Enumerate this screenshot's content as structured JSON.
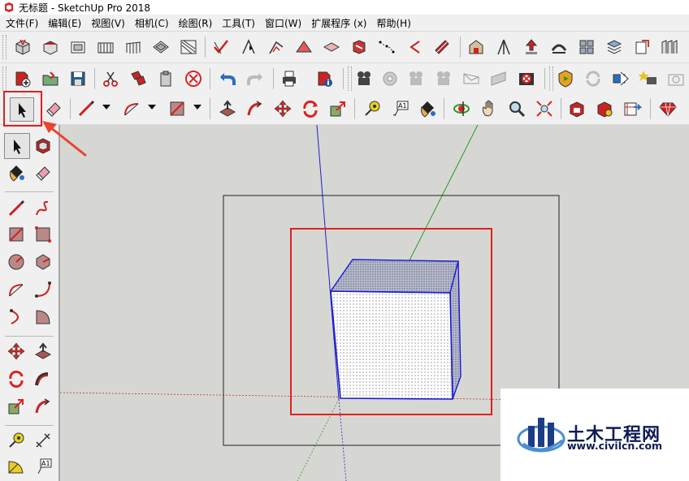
{
  "window": {
    "title": "无标题 - SketchUp Pro 2018"
  },
  "menu": [
    "文件(F)",
    "编辑(E)",
    "视图(V)",
    "相机(C)",
    "绘图(R)",
    "工具(T)",
    "窗口(W)",
    "扩展程序 (x)",
    "帮助(H)"
  ],
  "toolbar": {
    "text_tool_label": "A1"
  },
  "left_toolbar": {
    "text_tool_label": "A1"
  },
  "watermark": {
    "name": "土木工程网",
    "url": "www.civilcn.com"
  },
  "colors": {
    "highlight": "#e02020",
    "arrow": "#e8452e",
    "axis_blue": "#2020c8",
    "axis_green": "#2a9a2a",
    "axis_red": "#c03030",
    "box_edge": "#1818d8"
  }
}
